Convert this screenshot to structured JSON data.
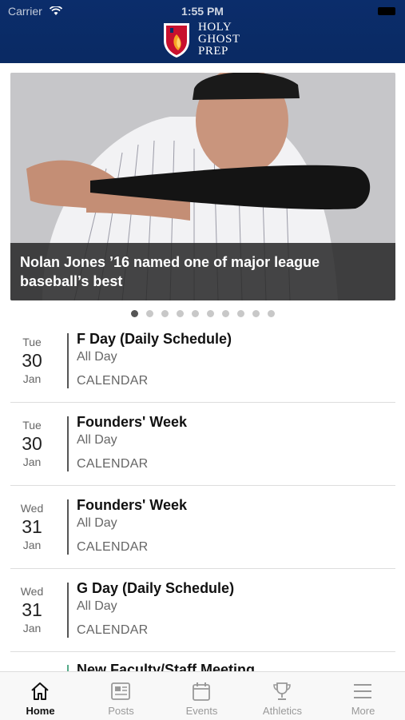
{
  "status_bar": {
    "carrier": "Carrier",
    "time": "1:55 PM"
  },
  "header": {
    "logo_lines": [
      "HOLY",
      "GHOST",
      "PREP"
    ]
  },
  "hero": {
    "caption": "Nolan Jones  ’16 named one of major league baseball’s best",
    "slide_count": 10,
    "active_slide": 0
  },
  "events": [
    {
      "dow": "Tue",
      "day": "30",
      "month": "Jan",
      "title": "F Day (Daily Schedule)",
      "time": "All Day",
      "category": "CALENDAR"
    },
    {
      "dow": "Tue",
      "day": "30",
      "month": "Jan",
      "title": "Founders' Week",
      "time": "All Day",
      "category": "CALENDAR"
    },
    {
      "dow": "Wed",
      "day": "31",
      "month": "Jan",
      "title": "Founders' Week",
      "time": "All Day",
      "category": "CALENDAR"
    },
    {
      "dow": "Wed",
      "day": "31",
      "month": "Jan",
      "title": "G Day (Daily Schedule)",
      "time": "All Day",
      "category": "CALENDAR"
    }
  ],
  "partial_event": {
    "title": "New Faculty/Staff Meeting"
  },
  "tabs": [
    {
      "label": "Home",
      "icon": "home-icon",
      "active": true
    },
    {
      "label": "Posts",
      "icon": "posts-icon",
      "active": false
    },
    {
      "label": "Events",
      "icon": "calendar-icon",
      "active": false
    },
    {
      "label": "Athletics",
      "icon": "trophy-icon",
      "active": false
    },
    {
      "label": "More",
      "icon": "menu-icon",
      "active": false
    }
  ],
  "colors": {
    "header": "#0b2d6b",
    "caption_bg": "#2b2b2b",
    "active_tab": "#111111",
    "inactive_tab": "#999999"
  }
}
